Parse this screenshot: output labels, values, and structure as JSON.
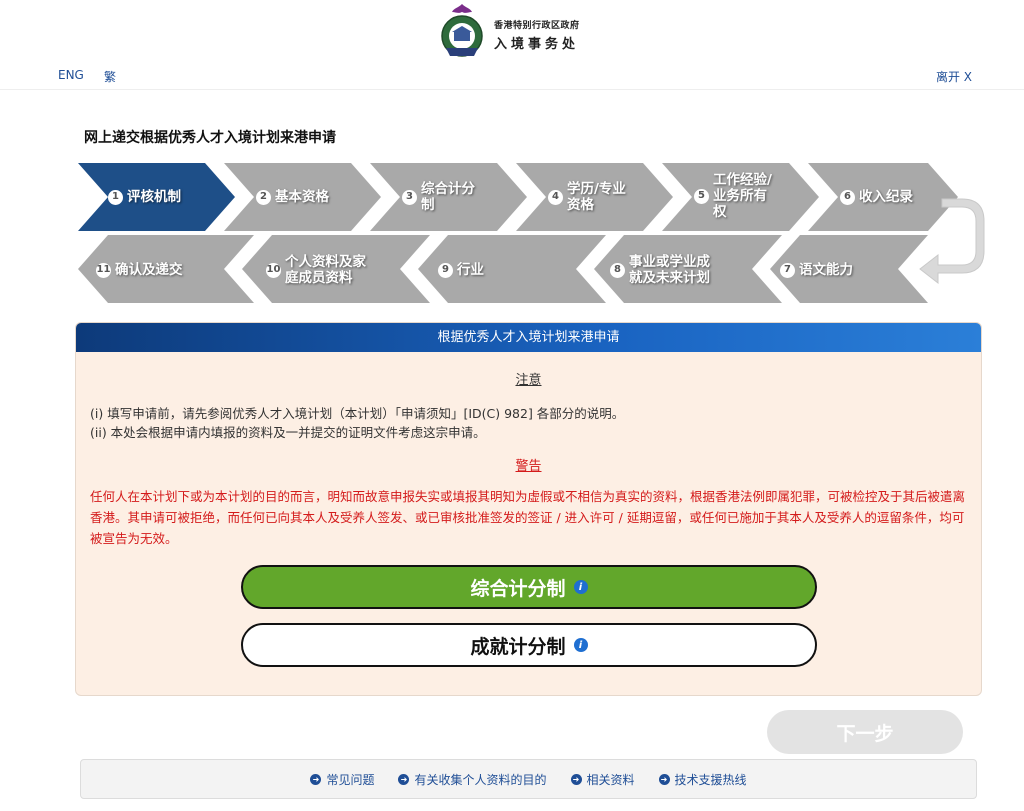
{
  "header": {
    "dept_line1": "香港特别行政区政府",
    "dept_line2": "入境事务处",
    "lang_eng": "ENG",
    "lang_tc": "繁",
    "leave": "离开 X"
  },
  "page_title": "网上递交根据优秀人才入境计划来港申请",
  "steps": [
    {
      "num": "1",
      "label": "评核机制",
      "active": true
    },
    {
      "num": "2",
      "label": "基本资格"
    },
    {
      "num": "3",
      "label": "综合计分制"
    },
    {
      "num": "4",
      "label": "学历/专业资格"
    },
    {
      "num": "5",
      "label": "工作经验/业务所有权"
    },
    {
      "num": "6",
      "label": "收入纪录"
    },
    {
      "num": "7",
      "label": "语文能力"
    },
    {
      "num": "8",
      "label": "事业或学业成就及未来计划"
    },
    {
      "num": "9",
      "label": "行业"
    },
    {
      "num": "10",
      "label": "个人资料及家庭成员资料"
    },
    {
      "num": "11",
      "label": "确认及递交"
    }
  ],
  "panel": {
    "header": "根据优秀人才入境计划来港申请",
    "notice_title": "注意",
    "notice_1": "(i) 填写申请前，请先参阅优秀人才入境计划（本计划）「申请须知」[ID(C) 982] 各部分的说明。",
    "notice_2": "(ii) 本处会根据申请内填报的资料及一并提交的证明文件考虑这宗申请。",
    "warning_title": "警告",
    "warning_text": "任何人在本计划下或为本计划的目的而言，明知而故意申报失实或填报其明知为虚假或不相信为真实的资料，根据香港法例即属犯罪，可被检控及于其后被遣离香港。其申请可被拒绝，而任何已向其本人及受养人签发、或已审核批准签发的签证 / 进入许可 / 延期逗留，或任何已施加于其本人及受养人的逗留条件，均可被宣告为无效。",
    "choice_1": "综合计分制",
    "choice_2": "成就计分制"
  },
  "next_button": "下一步",
  "footer": {
    "links": [
      "常见问题",
      "有关收集个人资料的目的",
      "相关资料",
      "技术支援热线"
    ]
  },
  "colors": {
    "active_step": "#1e4f88",
    "inactive_step": "#a9a9a9",
    "panel_bg": "#fdefe4",
    "choice_green": "#62a72b",
    "warning_red": "#d41b1b"
  }
}
